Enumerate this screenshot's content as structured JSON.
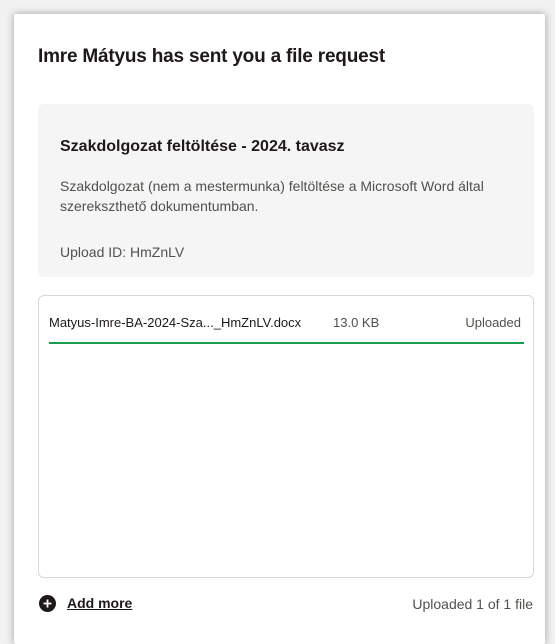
{
  "dialog": {
    "title": "Imre Mátyus has sent you a file request"
  },
  "request": {
    "title": "Szakdolgozat feltöltése - 2024. tavasz",
    "description": "Szakdolgozat (nem a mestermunka) feltöltése a Microsoft Word által szerekszthető dokumentumban.",
    "upload_id": "Upload ID: HmZnLV"
  },
  "files": [
    {
      "name": "Matyus-Imre-BA-2024-Sza..._HmZnLV.docx",
      "size": "13.0 KB",
      "status": "Uploaded",
      "progress": 1.0
    }
  ],
  "footer": {
    "add_more": "Add more",
    "count": "Uploaded 1 of 1 file"
  },
  "colors": {
    "progress": "#1a9c52",
    "text": "#1e1919"
  }
}
